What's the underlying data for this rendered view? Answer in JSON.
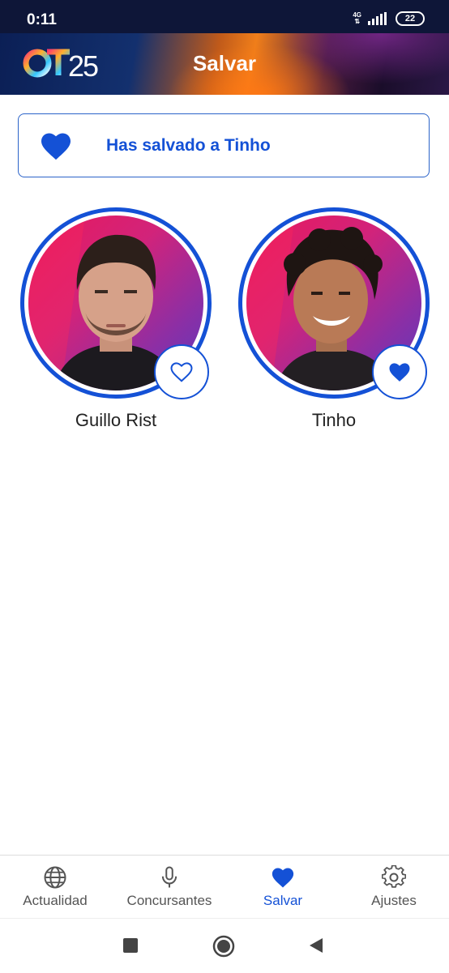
{
  "status_bar": {
    "time": "0:11",
    "network": "4G",
    "battery": "22"
  },
  "header": {
    "logo_text": "OT25",
    "title": "Salvar"
  },
  "banner": {
    "message": "Has salvado a Tinho",
    "icon": "heart-filled-icon"
  },
  "contestants": [
    {
      "name": "Guillo Rist",
      "saved": false
    },
    {
      "name": "Tinho",
      "saved": true
    }
  ],
  "bottom_nav": {
    "items": [
      {
        "label": "Actualidad",
        "icon": "globe-icon",
        "active": false
      },
      {
        "label": "Concursantes",
        "icon": "microphone-icon",
        "active": false
      },
      {
        "label": "Salvar",
        "icon": "heart-icon",
        "active": true
      },
      {
        "label": "Ajustes",
        "icon": "gear-icon",
        "active": false
      }
    ]
  },
  "colors": {
    "accent": "#1451d6",
    "status_bar": "#0e1638"
  }
}
